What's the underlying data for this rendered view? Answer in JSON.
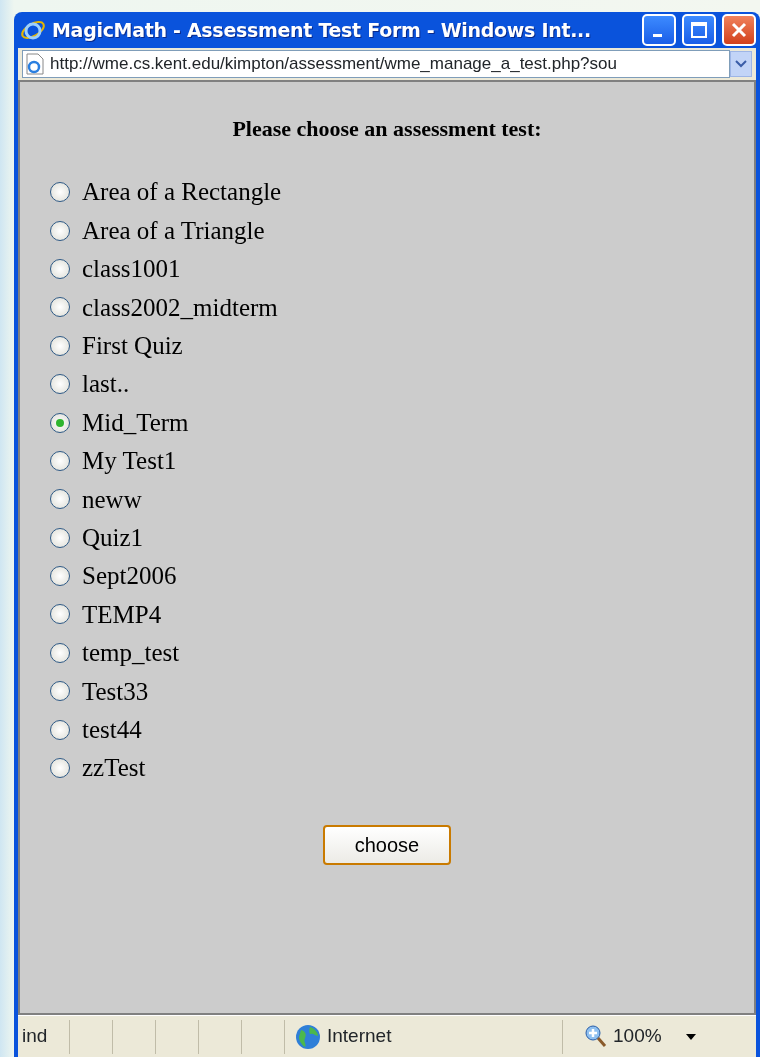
{
  "window": {
    "title": "MagicMath - Assessment Test Form - Windows Int..."
  },
  "address_bar": {
    "url": "http://wme.cs.kent.edu/kimpton/assessment/wme_manage_a_test.php?sou"
  },
  "form": {
    "heading": "Please choose an assessment test:",
    "options": [
      {
        "label": "Area of a Rectangle",
        "selected": false
      },
      {
        "label": "Area of a Triangle",
        "selected": false
      },
      {
        "label": "class1001",
        "selected": false
      },
      {
        "label": "class2002_midterm",
        "selected": false
      },
      {
        "label": "First Quiz",
        "selected": false
      },
      {
        "label": "last..",
        "selected": false
      },
      {
        "label": "Mid_Term",
        "selected": true
      },
      {
        "label": "My Test1",
        "selected": false
      },
      {
        "label": "neww",
        "selected": false
      },
      {
        "label": "Quiz1",
        "selected": false
      },
      {
        "label": "Sept2006",
        "selected": false
      },
      {
        "label": "TEMP4",
        "selected": false
      },
      {
        "label": "temp_test",
        "selected": false
      },
      {
        "label": "Test33",
        "selected": false
      },
      {
        "label": "test44",
        "selected": false
      },
      {
        "label": "zzTest",
        "selected": false
      }
    ],
    "button": "choose"
  },
  "status_bar": {
    "status_text": "ind",
    "zone": "Internet",
    "zoom": "100%"
  }
}
